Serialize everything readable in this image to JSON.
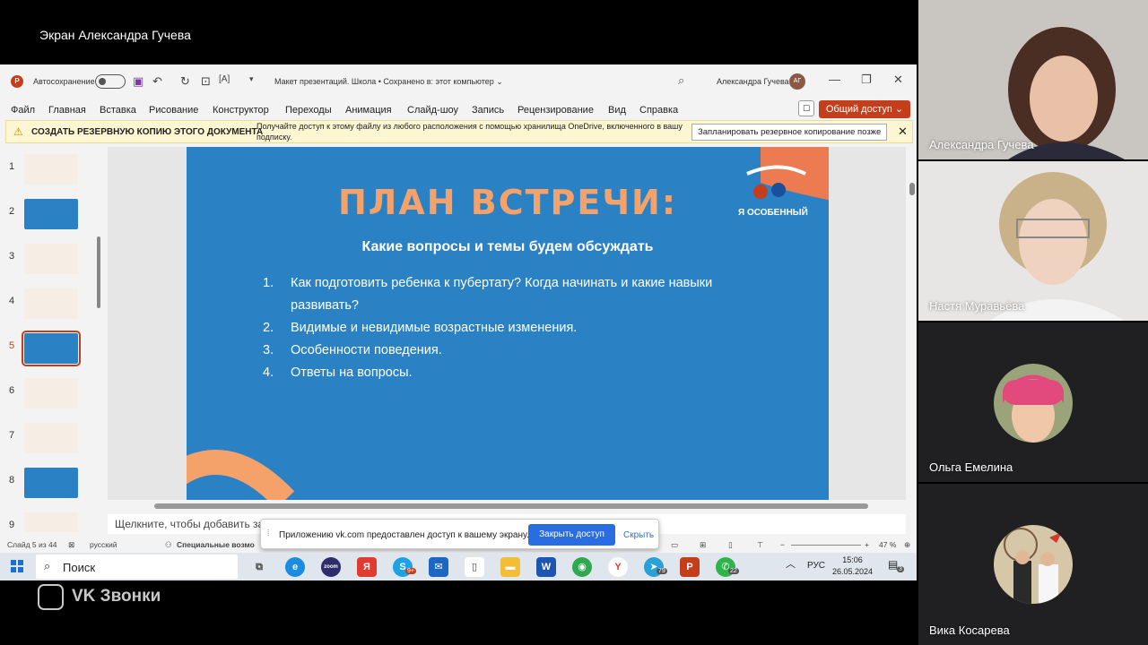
{
  "share_title": "Экран Александра Гучева",
  "ppt": {
    "app_icon": "P",
    "autosave_label": "Автосохранение",
    "doc_title": "Макет презентаций. Школа • Сохранено в: этот компьютер ⌄",
    "user_name": "Александра Гучева",
    "user_initials": "АГ",
    "menu": [
      "Файл",
      "Главная",
      "Вставка",
      "Рисование",
      "Конструктор",
      "Переходы",
      "Анимация",
      "Слайд-шоу",
      "Запись",
      "Рецензирование",
      "Вид",
      "Справка"
    ],
    "share_button": "Общий доступ ⌄",
    "notice": {
      "bold": "СОЗДАТЬ РЕЗЕРВНУЮ КОПИЮ ЭТОГО ДОКУМЕНТА",
      "message": "Получайте доступ к этому файлу из любого расположения с помощью хранилища OneDrive, включенного в вашу подписку.",
      "schedule_button": "Запланировать резервное копирование позже",
      "close": "✕"
    },
    "thumbnails": [
      {
        "num": "1",
        "color": "#f6ede4"
      },
      {
        "num": "2",
        "color": "#2a82c5"
      },
      {
        "num": "3",
        "color": "#f6ede4"
      },
      {
        "num": "4",
        "color": "#f6ede4"
      },
      {
        "num": "5",
        "color": "#2a82c5"
      },
      {
        "num": "6",
        "color": "#f6ede4"
      },
      {
        "num": "7",
        "color": "#f6ede4"
      },
      {
        "num": "8",
        "color": "#2a82c5"
      },
      {
        "num": "9",
        "color": "#f6ede4"
      }
    ],
    "slide": {
      "title": "ПЛАН ВСТРЕЧИ:",
      "subtitle": "Какие вопросы и темы будем обсуждать",
      "logo_text": "Я ОСОБЕННЫЙ",
      "items": [
        {
          "num": "1.",
          "text": "Как подготовить ребенка к пубертату? Когда начинать и какие навыки развивать?"
        },
        {
          "num": "2.",
          "text": "Видимые и невидимые возрастные изменения."
        },
        {
          "num": "3.",
          "text": "Особенности поведения."
        },
        {
          "num": "4.",
          "text": "Ответы на вопросы."
        }
      ]
    },
    "notes_placeholder": "Щелкните, чтобы добавить за",
    "status": {
      "slide_count": "Слайд 5 из 44",
      "language": "русский",
      "accessibility": "Специальные возмо",
      "zoom": "47 %"
    }
  },
  "share_popup": {
    "text": "Приложению vk.com предоставлен доступ к вашему экрану.",
    "close_button": "Закрыть доступ",
    "hide_link": "Скрыть"
  },
  "taskbar": {
    "search": "Поиск",
    "lang": "РУС",
    "time": "15:06",
    "date": "26.05.2024",
    "notifications": "3",
    "badges": {
      "skype": "9+",
      "telegram": "79",
      "whatsapp": "22"
    }
  },
  "vk": {
    "brand": "VK Звонки"
  },
  "participants": [
    {
      "name": "Александра Гучева",
      "active": true
    },
    {
      "name": "Настя Муравьёва",
      "active": false
    },
    {
      "name": "Ольга Емелина",
      "active": false
    },
    {
      "name": "Вика Косарева",
      "active": false
    }
  ]
}
